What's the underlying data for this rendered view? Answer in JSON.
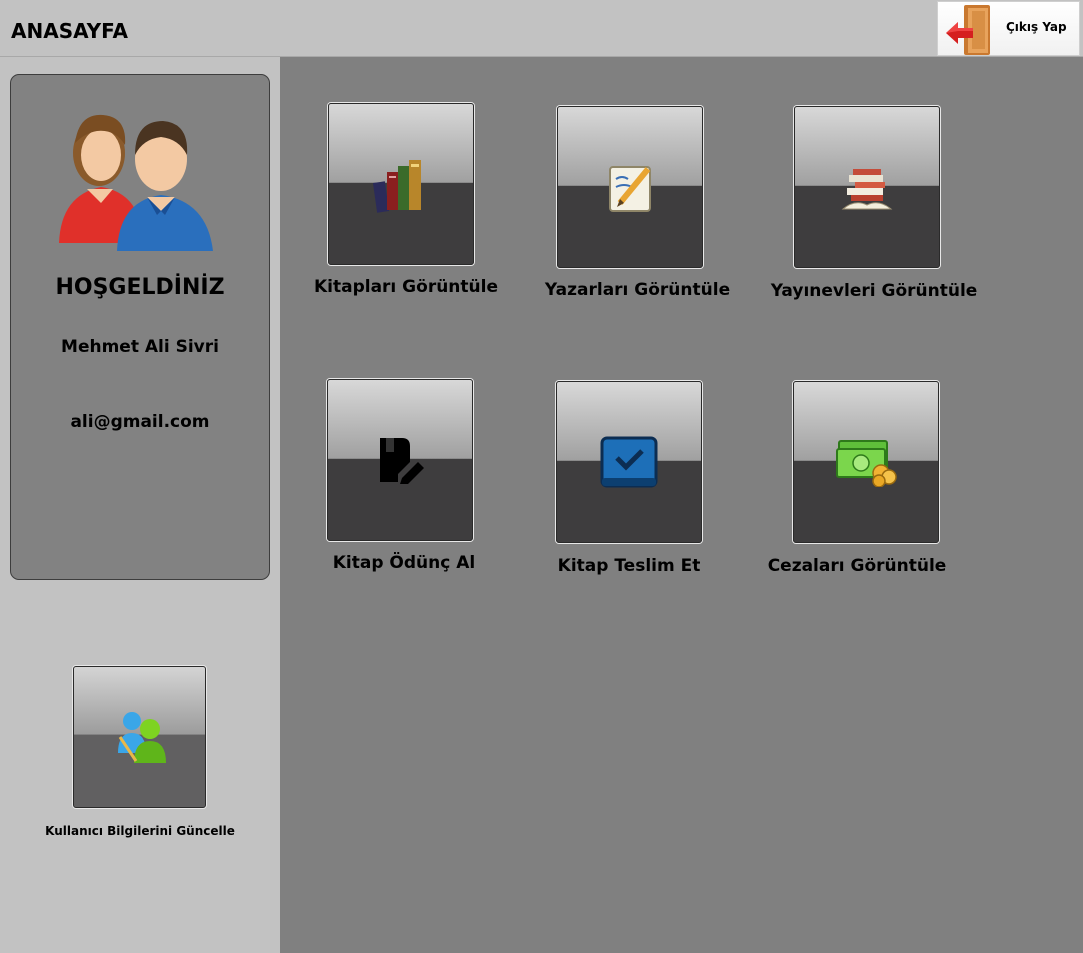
{
  "header": {
    "title": "ANASAYFA",
    "logout_label": "Çıkış Yap"
  },
  "profile": {
    "welcome": "HOŞGELDİNİZ",
    "name": "Mehmet Ali Sivri",
    "email": "ali@gmail.com"
  },
  "actions": {
    "view_books": "Kitapları Görüntüle",
    "view_authors": "Yazarları Görüntüle",
    "view_publishers": "Yayınevleri Görüntüle",
    "borrow_book": "Kitap Ödünç Al",
    "return_book": "Kitap Teslim Et",
    "view_fines": "Cezaları Görüntüle"
  },
  "sidebar": {
    "update_user_label": "Kullanıcı Bilgilerini Güncelle"
  },
  "icons": {
    "logout": "door-exit-icon",
    "profile": "users-icon",
    "view_books": "books-icon",
    "view_authors": "notepad-pencil-icon",
    "view_publishers": "stacked-books-icon",
    "borrow_book": "book-edit-icon",
    "return_book": "book-check-icon",
    "view_fines": "money-icon",
    "update_user": "users-edit-icon"
  }
}
